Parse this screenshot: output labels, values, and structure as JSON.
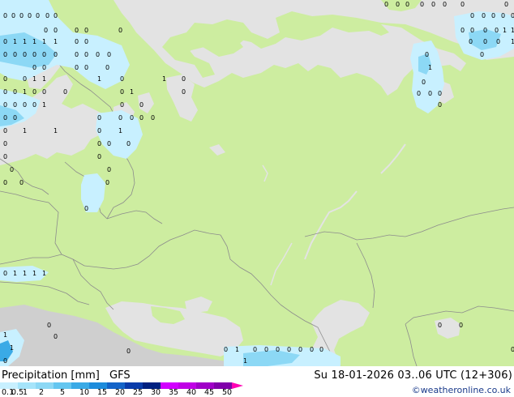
{
  "header": {
    "product_label": "Precipitation [mm]",
    "model_label": "GFS",
    "datetime": "Su 18-01-2026 03..06 UTC (12+306)",
    "credit": "©weatheronline.co.uk"
  },
  "legend": {
    "labels": [
      "0.1",
      "0.5",
      "1",
      "2",
      "5",
      "10",
      "15",
      "20",
      "25",
      "30",
      "35",
      "40",
      "45",
      "50"
    ],
    "colors": [
      "#c8f0ff",
      "#a6e4fa",
      "#8cd8f5",
      "#64c6f0",
      "#3aaae6",
      "#1e8cdc",
      "#1464c8",
      "#0a3caa",
      "#002080",
      "#d200ff",
      "#c000e6",
      "#a000c8",
      "#8000aa",
      "#ff00b4"
    ]
  },
  "map_colors": {
    "land": "#cdeda0",
    "sea": "#e3e3e3",
    "no_land": "#cfcfcf",
    "border": "#8c8c8c",
    "precip_light": "#c8f0ff",
    "precip_medium": "#8cd8f5",
    "precip_heavy": "#3aaae6"
  },
  "map": {
    "row_1": [
      "0",
      "0",
      "0",
      "0",
      "0",
      "0",
      "0",
      "0",
      "0",
      "0",
      "0",
      "0",
      "0",
      "0",
      "0",
      "0",
      "0",
      "0",
      "0",
      "0"
    ],
    "row_2": [
      "0",
      "0",
      "0",
      "0",
      "0",
      "0",
      "0",
      "0",
      "0",
      "1",
      "1",
      "1"
    ],
    "row_3": [
      "0",
      "1",
      "1",
      "1",
      "1",
      "1",
      "0",
      "0",
      "0",
      "0",
      "0"
    ],
    "row_4": [
      "0",
      "0",
      "0",
      "0",
      "0",
      "0",
      "0",
      "0",
      "0",
      "0"
    ],
    "row_5": [
      "0",
      "0",
      "0",
      "0",
      "0",
      "1",
      "0",
      "0"
    ],
    "row_6": [
      "0",
      "0",
      "1",
      "1",
      "1",
      "0",
      "1",
      "0",
      "0",
      "0",
      "0"
    ],
    "row_7": [
      "0",
      "0",
      "1",
      "0",
      "0",
      "0",
      "0",
      "1",
      "0",
      "0",
      "0"
    ],
    "row_8": [
      "0",
      "0",
      "0",
      "0",
      "1",
      "0",
      "0"
    ],
    "row_9": [
      "0",
      "0",
      "0",
      "0",
      "0",
      "0",
      "0"
    ],
    "row_10": [
      "0",
      "1",
      "1",
      "0",
      "1"
    ],
    "row_11": [
      "0",
      "0",
      "0",
      "0",
      "0",
      "0",
      "0",
      "0",
      "0",
      "0",
      "0",
      "0"
    ],
    "row_12": [
      "0",
      "1",
      "1",
      "1",
      "1",
      "1",
      "1",
      "0",
      "1",
      "1"
    ]
  }
}
